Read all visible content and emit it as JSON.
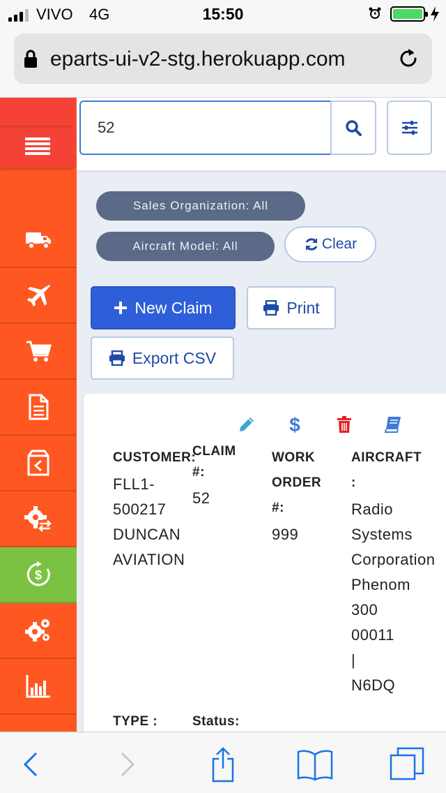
{
  "status_bar": {
    "carrier": "VIVO",
    "network": "4G",
    "time": "15:50",
    "battery_level": 1.0
  },
  "browser": {
    "url": "eparts-ui-v2-stg.herokuapp.com"
  },
  "sidebar": {
    "items": [
      {
        "icon": "menu-icon"
      },
      {
        "icon": "truck-icon"
      },
      {
        "icon": "plane-icon"
      },
      {
        "icon": "cart-icon"
      },
      {
        "icon": "document-icon"
      },
      {
        "icon": "return-box-icon"
      },
      {
        "icon": "gear-exchange-icon"
      },
      {
        "icon": "refund-dollar-icon",
        "active": true
      },
      {
        "icon": "gears-icon"
      },
      {
        "icon": "bar-chart-icon"
      }
    ],
    "colors": {
      "base": "#ff5722",
      "active": "#7cc242",
      "menu": "#f44336"
    }
  },
  "search": {
    "value": "52"
  },
  "filters": {
    "sales_org": "Sales Organization: All",
    "aircraft_model": "Aircraft Model: All",
    "clear_label": "Clear"
  },
  "actions": {
    "new_claim": "New Claim",
    "print": "Print",
    "export_csv": "Export CSV"
  },
  "claim": {
    "customer_label": "CUSTOMER:",
    "customer_lines": [
      "FLL1-",
      "500217",
      "DUNCAN",
      "AVIATION"
    ],
    "claim_label_lines": [
      "CLAIM",
      "#:"
    ],
    "claim_value": "52",
    "work_order_label_lines": [
      "WORK",
      "ORDER",
      "#:"
    ],
    "work_order_value": "999",
    "aircraft_label_lines": [
      "AIRCRAFT",
      ":"
    ],
    "aircraft_lines": [
      "Radio",
      "Systems",
      "Corporation",
      "Phenom",
      "300",
      "00011",
      "|",
      "N6DQ"
    ],
    "type_label": "TYPE :",
    "status_label": "Status:"
  },
  "card_actions": [
    {
      "icon": "pencil-icon",
      "color": "#3aa6d8"
    },
    {
      "icon": "dollar-icon",
      "color": "#3f7ad8"
    },
    {
      "icon": "trash-icon",
      "color": "#e02424"
    },
    {
      "icon": "book-icon",
      "color": "#3f7ad8"
    }
  ]
}
